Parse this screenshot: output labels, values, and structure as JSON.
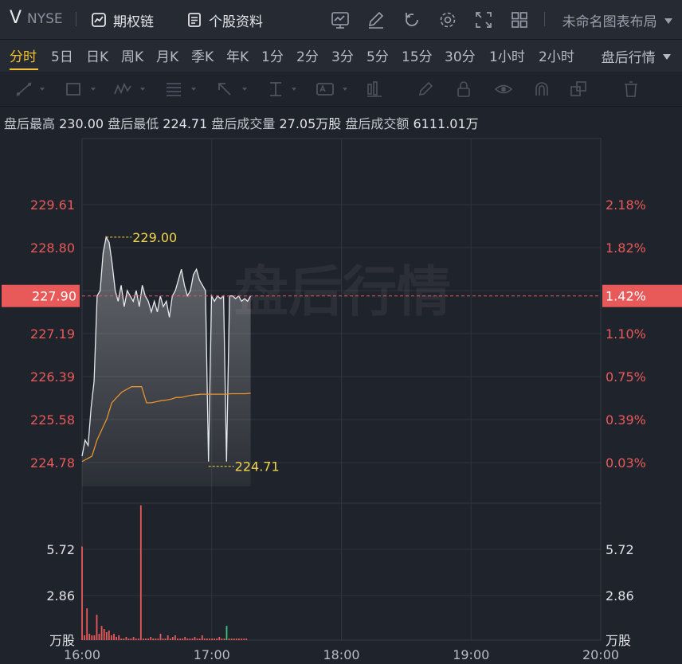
{
  "header": {
    "symbol": "V",
    "exchange": "NYSE",
    "options_chain": "期权链",
    "stock_profile": "个股资料",
    "layout_name": "未命名图表布局"
  },
  "periods": {
    "tabs": [
      "分时",
      "5日",
      "日K",
      "周K",
      "月K",
      "季K",
      "年K",
      "1分",
      "2分",
      "3分",
      "5分",
      "15分",
      "30分",
      "1小时",
      "2小时"
    ],
    "active": "分时",
    "after_hours_tab": "盘后行情"
  },
  "info": {
    "high_label": "盘后最高",
    "high_value": "230.00",
    "low_label": "盘后最低",
    "low_value": "224.71",
    "volume_label": "盘后成交量",
    "volume_value": "27.05万股",
    "turnover_label": "盘后成交额",
    "turnover_value": "6111.01万"
  },
  "watermark": "盘后行情",
  "colors": {
    "up": "#e85a5a",
    "avg": "#e8922e",
    "price": "#e6e8ec",
    "annotation": "#f2d64b",
    "volume_green": "#3ac47a"
  },
  "chart_data": {
    "type": "line",
    "time_range": [
      "16:00",
      "20:00"
    ],
    "x_ticks": [
      "16:00",
      "17:00",
      "18:00",
      "19:00",
      "20:00"
    ],
    "ylim": [
      224.78,
      229.61
    ],
    "price_ticks": [
      "229.61",
      "228.80",
      "227.19",
      "226.39",
      "225.58",
      "224.78"
    ],
    "pct_ticks": [
      "2.18%",
      "1.82%",
      "1.10%",
      "0.75%",
      "0.39%",
      "0.03%"
    ],
    "reference_price": "227.90",
    "reference_pct": "1.42%",
    "high_label": "229.00",
    "low_label": "224.71",
    "price_series": [
      224.9,
      225.2,
      225.1,
      225.8,
      226.3,
      227.9,
      228.0,
      228.7,
      229.0,
      228.9,
      228.5,
      228.0,
      227.8,
      228.1,
      227.7,
      228.0,
      227.9,
      227.8,
      228.0,
      227.7,
      228.1,
      227.9,
      227.8,
      227.6,
      227.8,
      227.6,
      227.9,
      227.7,
      227.8,
      227.5,
      227.9,
      228.0,
      228.2,
      228.4,
      228.1,
      227.9,
      228.0,
      228.3,
      228.4,
      228.2,
      228.1,
      228.0,
      224.8,
      227.9,
      227.8,
      227.9,
      227.85,
      227.9,
      224.8,
      227.9,
      227.9,
      227.85,
      227.9,
      227.8,
      227.85,
      227.8,
      227.9
    ],
    "avg_series": [
      224.8,
      224.85,
      224.9,
      225.2,
      225.4,
      225.6,
      225.9,
      226.0,
      226.1,
      226.15,
      226.2,
      226.2,
      226.2,
      225.9,
      225.9,
      225.92,
      225.94,
      225.95,
      225.97,
      226.0,
      226.0,
      226.02,
      226.04,
      226.05,
      226.06,
      226.06,
      226.06,
      226.06,
      226.06,
      226.06,
      226.07,
      226.07,
      226.07,
      226.07,
      226.08
    ],
    "volume_max_label": "5.72",
    "volume_mid_label": "2.86",
    "volume_unit": "万股",
    "volume_series": [
      5.9,
      0.3,
      2.0,
      0.4,
      0.3,
      0.3,
      1.6,
      0.4,
      0.9,
      0.7,
      0.5,
      0.6,
      0.3,
      0.4,
      0.2,
      0.3,
      0.1,
      0.1,
      0.2,
      0.1,
      0.1,
      0.2,
      0.1,
      0.1,
      8.5,
      0.1,
      0.1,
      0.1,
      0.2,
      0.1,
      0.1,
      0.1,
      0.4,
      0.1,
      0.1,
      0.3,
      0.1,
      0.2,
      0.3,
      0.1,
      0.1,
      0.1,
      0.2,
      0.1,
      0.1,
      0.1,
      0.2,
      0.1,
      0.1,
      0.3,
      0.1,
      0.1,
      0.1,
      0.1,
      0.1,
      0.1,
      0.2,
      0.1,
      0.1,
      0.9,
      0.1,
      0.1,
      0.1,
      0.1,
      0.1,
      0.1,
      0.1,
      0.1
    ]
  }
}
